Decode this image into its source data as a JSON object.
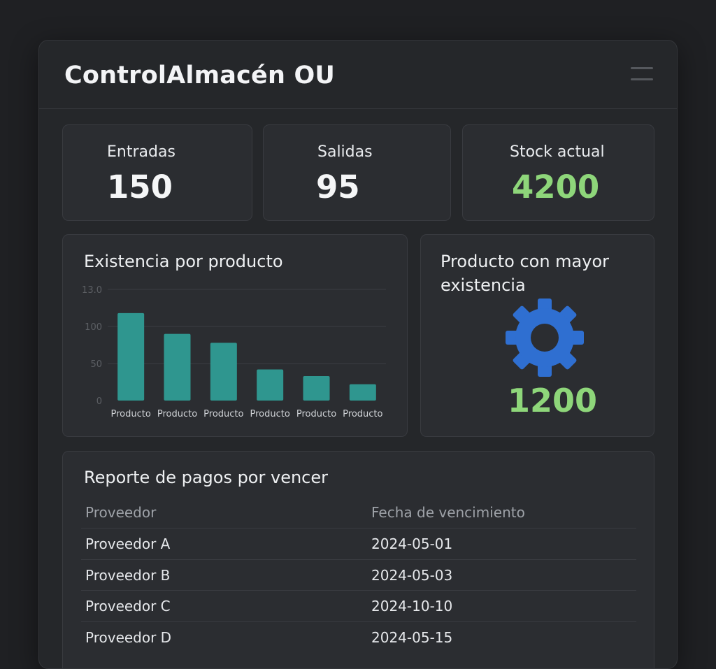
{
  "app": {
    "title": "ControlAlmacén OU"
  },
  "stats": [
    {
      "label": "Entradas",
      "value": "150"
    },
    {
      "label": "Salidas",
      "value": "95"
    },
    {
      "label": "Stock actual",
      "value": "4200"
    }
  ],
  "colors": {
    "accent_green": "#8ed67a",
    "bar_teal": "#2f968f",
    "gear_blue": "#2f6fd1"
  },
  "chart_panel": {
    "title": "Existencia por producto"
  },
  "chart_data": {
    "type": "bar",
    "categories": [
      "Producto",
      "Producto",
      "Producto",
      "Producto",
      "Producto",
      "Producto"
    ],
    "values": [
      118,
      90,
      78,
      42,
      33,
      22
    ],
    "ylim": [
      0,
      150
    ],
    "yticks": [
      0,
      50,
      100,
      150
    ],
    "ytick_labels": [
      "0",
      "50",
      "100",
      "13.0"
    ],
    "grid": true,
    "title": "",
    "xlabel": "",
    "ylabel": ""
  },
  "top_product": {
    "title": "Producto con mayor existencia",
    "icon": "gear-icon",
    "value": "1200"
  },
  "report": {
    "title": "Reporte de pagos por vencer",
    "columns": [
      "Proveedor",
      "Fecha de vencimiento"
    ],
    "rows": [
      [
        "Proveedor A",
        "2024-05-01"
      ],
      [
        "Proveedor B",
        "2024-05-03"
      ],
      [
        "Proveedor C",
        "2024-10-10"
      ],
      [
        "Proveedor D",
        "2024-05-15"
      ]
    ]
  }
}
